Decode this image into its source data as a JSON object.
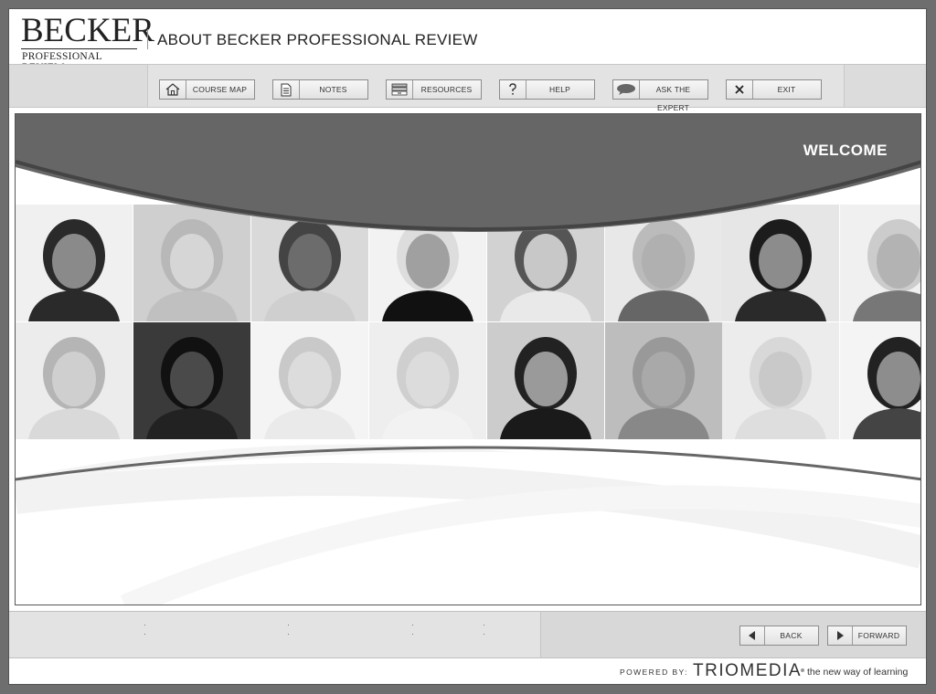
{
  "header": {
    "logo_main": "BECKER",
    "logo_sub": "PROFESSIONAL REVIEW",
    "title": "ABOUT BECKER PROFESSIONAL REVIEW"
  },
  "toolbar": {
    "buttons": [
      {
        "label": "COURSE MAP",
        "icon": "home-icon"
      },
      {
        "label": "NOTES",
        "icon": "notes-icon"
      },
      {
        "label": "RESOURCES",
        "icon": "resources-icon"
      },
      {
        "label": "HELP",
        "icon": "help-icon"
      },
      {
        "label": "ASK THE EXPERT",
        "icon": "speech-bubble-icon"
      },
      {
        "label": "EXIT",
        "icon": "close-icon"
      }
    ]
  },
  "content": {
    "welcome": "WELCOME",
    "banner_color": "#666666"
  },
  "nav": {
    "back_label": "BACK",
    "forward_label": "FORWARD"
  },
  "footer": {
    "powered_by": "POWERED BY:",
    "brand": "TRIOMEDIA",
    "tagline": "the new way of learning"
  }
}
